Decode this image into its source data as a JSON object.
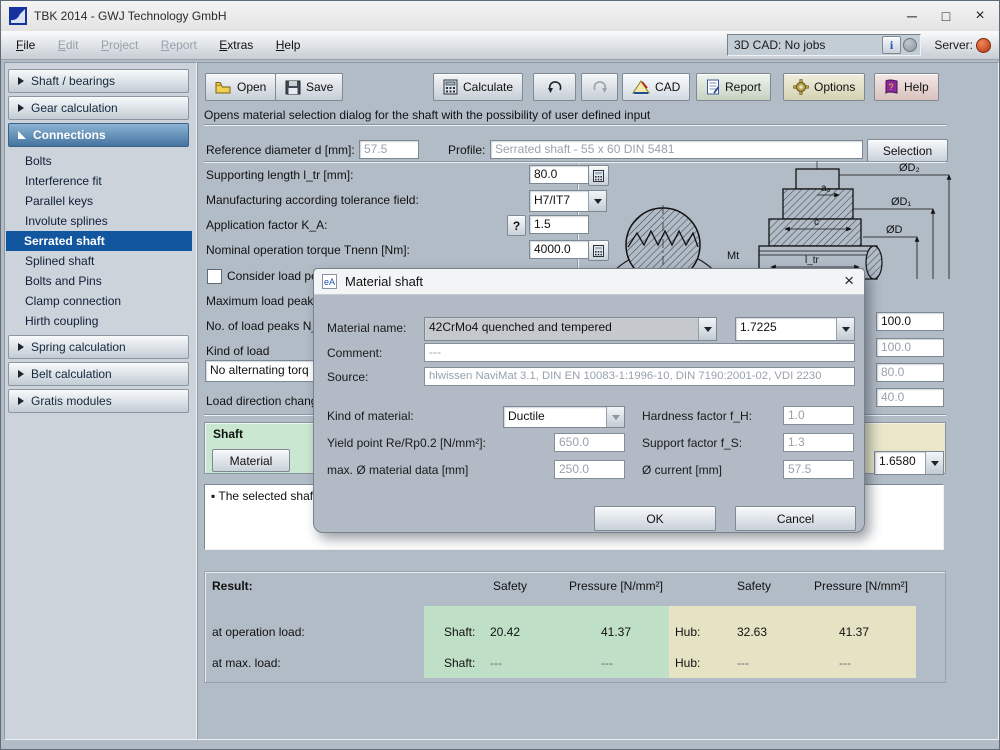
{
  "window": {
    "title": "TBK 2014 - GWJ Technology GmbH",
    "minimize": "─",
    "maximize": "□",
    "close": "×"
  },
  "menubar": {
    "items": [
      {
        "label": "File",
        "enabled": true
      },
      {
        "label": "Edit",
        "enabled": false
      },
      {
        "label": "Project",
        "enabled": false
      },
      {
        "label": "Report",
        "enabled": false
      },
      {
        "label": "Extras",
        "enabled": true
      },
      {
        "label": "Help",
        "enabled": true
      }
    ],
    "cad_status": "3D CAD: No jobs",
    "info_button": "i",
    "server_label": "Server:"
  },
  "colors": {
    "selection_blue": "#1256a0",
    "section_header_blue": "#44749f",
    "result_green": "#c0dfc7",
    "result_tan": "#e6e2c4",
    "panel_green": "#cae8d1",
    "panel_beige": "#e9e6c9",
    "server_led_red": "#d2491e",
    "cad_led_gray": "#9aa2a8"
  },
  "sidebar": {
    "items": [
      {
        "label": "Shaft / bearings"
      },
      {
        "label": "Gear calculation"
      },
      {
        "label": "Connections"
      },
      {
        "label": "Bolts"
      },
      {
        "label": "Interference fit"
      },
      {
        "label": "Parallel keys"
      },
      {
        "label": "Involute splines"
      },
      {
        "label": "Serrated shaft"
      },
      {
        "label": "Splined shaft"
      },
      {
        "label": "Bolts and Pins"
      },
      {
        "label": "Clamp connection"
      },
      {
        "label": "Hirth coupling"
      },
      {
        "label": "Spring calculation"
      },
      {
        "label": "Belt calculation"
      },
      {
        "label": "Gratis modules"
      }
    ]
  },
  "toolbar": {
    "open": "Open",
    "save": "Save",
    "calculate": "Calculate",
    "cad": "CAD",
    "report": "Report",
    "options": "Options",
    "help": "Help"
  },
  "status_text": "Opens material selection dialog for the shaft with the possibility of user defined input",
  "form": {
    "reference_diameter_label": "Reference diameter d [mm]:",
    "reference_diameter_value": "57.5",
    "profile_label": "Profile:",
    "profile_value": "Serrated shaft - 55 x 60 DIN 5481",
    "selection_button": "Selection",
    "supporting_length_label": "Supporting length l_tr [mm]:",
    "supporting_length_value": "80.0",
    "tolerance_label": "Manufacturing according tolerance field:",
    "tolerance_value": "H7/IT7",
    "application_factor_label": "Application factor K_A:",
    "application_factor_help": "?",
    "application_factor_value": "1.5",
    "torque_label": "Nominal operation torque Tnenn [Nm]:",
    "torque_value": "4000.0",
    "consider_load_label": "Consider load pe",
    "max_load_peak_label": "Maximum load peak",
    "load_peaks_label": "No. of load peaks N_",
    "kind_of_load_label": "Kind of load",
    "kind_of_load_value": "No alternating torq",
    "load_direction_label": "Load direction chang",
    "right_fields": [
      "100.0",
      "100.0",
      "80.0",
      "40.0"
    ]
  },
  "drawing": {
    "d2": "ØD₂",
    "d1": "ØD₁",
    "d": "ØD",
    "a0": "a₀",
    "c": "c",
    "ltr": "l_tr",
    "mt": "Mt"
  },
  "shaft_panel": {
    "title": "Shaft",
    "material_button": "Material"
  },
  "hub_panel": {
    "combo_value": "1.6580"
  },
  "message_area": {
    "text": "▪ The selected shaf"
  },
  "results": {
    "title": "Result:",
    "safety_header": "Safety",
    "pressure_header": "Pressure [N/mm²]",
    "rows": [
      {
        "label": "at operation load:",
        "shaft_label": "Shaft:",
        "shaft_safety": "20.42",
        "shaft_pressure": "41.37",
        "hub_label": "Hub:",
        "hub_safety": "32.63",
        "hub_pressure": "41.37"
      },
      {
        "label": "at max. load:",
        "shaft_label": "Shaft:",
        "shaft_safety": "---",
        "shaft_pressure": "---",
        "hub_label": "Hub:",
        "hub_safety": "---",
        "hub_pressure": "---"
      }
    ]
  },
  "dialog": {
    "icon": "eA",
    "title": "Material shaft",
    "close": "×",
    "material_name_label": "Material name:",
    "material_name_value": "42CrMo4 quenched and tempered",
    "material_number_value": "1.7225",
    "comment_label": "Comment:",
    "comment_value": "---",
    "source_label": "Source:",
    "source_value": "hlwissen NaviMat 3.1, DIN EN 10083-1:1996-10, DIN 7190:2001-02, VDI 2230",
    "kind_label": "Kind of material:",
    "kind_value": "Ductile",
    "hardness_label": "Hardness factor f_H:",
    "hardness_value": "1.0",
    "yield_label": "Yield point Re/Rp0.2 [N/mm²]:",
    "yield_value": "650.0",
    "support_label": "Support factor f_S:",
    "support_value": "1.3",
    "max_diameter_label": "max. Ø material data [mm]",
    "max_diameter_value": "250.0",
    "current_diameter_label": "Ø current [mm]",
    "current_diameter_value": "57.5",
    "ok_button": "OK",
    "cancel_button": "Cancel"
  }
}
